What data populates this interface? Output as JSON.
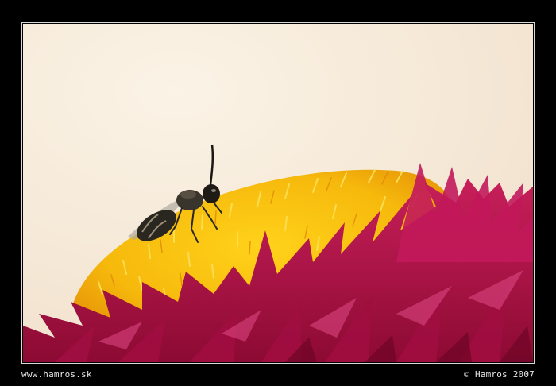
{
  "footer": {
    "website": "www.hamros.sk",
    "copyright": "© Hamros 2007"
  },
  "colors": {
    "background": "#f6ead8",
    "frame": "#000000",
    "petal": "#b0124a",
    "pollen": "#f5c012",
    "bee": "#2a2620"
  }
}
